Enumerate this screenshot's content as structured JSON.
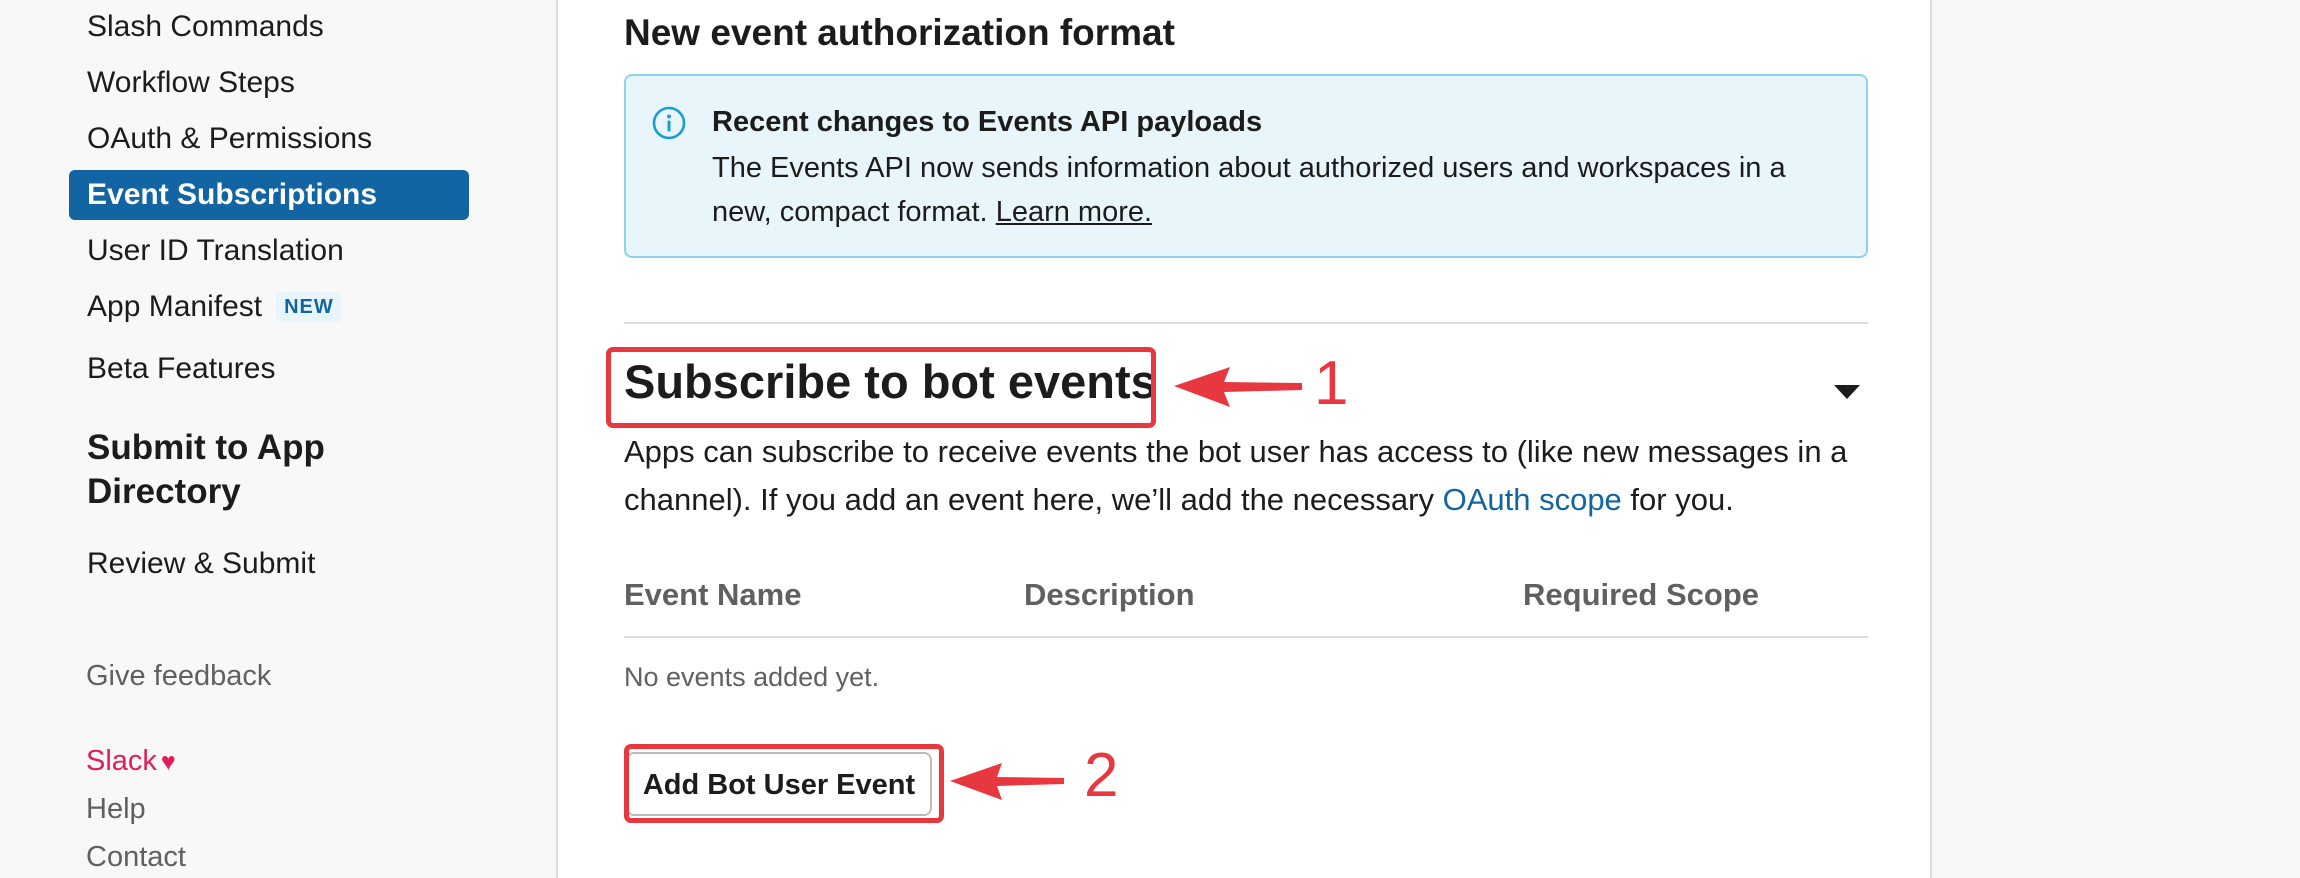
{
  "sidebar": {
    "items": [
      {
        "label": "Slash Commands"
      },
      {
        "label": "Workflow Steps"
      },
      {
        "label": "OAuth & Permissions"
      },
      {
        "label": "Event Subscriptions"
      },
      {
        "label": "User ID Translation"
      },
      {
        "label": "App Manifest",
        "badge": "NEW"
      },
      {
        "label": "Beta Features"
      }
    ],
    "submit_heading": "Submit to App Directory",
    "review_submit": "Review & Submit",
    "give_feedback": "Give feedback",
    "slack_love": "Slack",
    "help": "Help",
    "contact": "Contact"
  },
  "main": {
    "format_title": "New event authorization format",
    "info": {
      "title": "Recent changes to Events API payloads",
      "text": "The Events API now sends information about authorized users and workspaces in a new, compact format.",
      "link": "Learn more."
    },
    "bot_events": {
      "title": "Subscribe to bot events",
      "desc_before": "Apps can subscribe to receive events the bot user has access to (like new messages in a channel). If you add an event here, we’ll add the necessary",
      "desc_link": "OAuth scope",
      "desc_after": "for you.",
      "columns": [
        "Event Name",
        "Description",
        "Required Scope"
      ],
      "empty_text": "No events added yet.",
      "add_button": "Add Bot User Event"
    }
  },
  "annotations": {
    "label_1": "1",
    "label_2": "2",
    "color": "#e8383f"
  },
  "colors": {
    "accent": "#1264a3",
    "info_bg": "#e8f5fa",
    "info_border": "#8ed3ee",
    "slack_pink": "#e01e5a"
  }
}
